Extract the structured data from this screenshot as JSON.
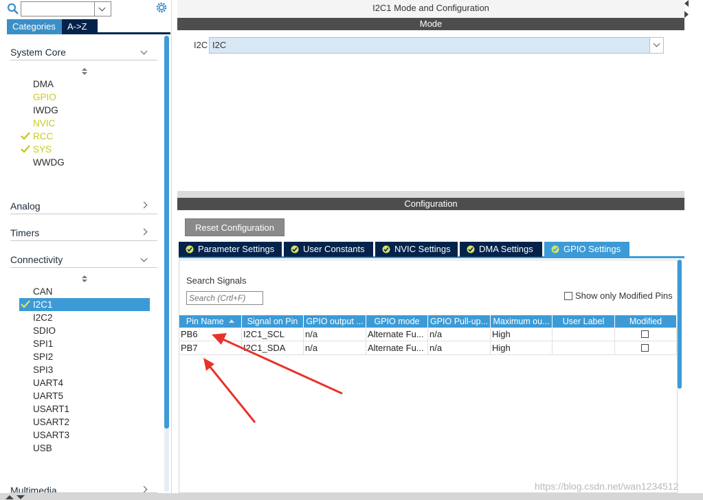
{
  "left_panel": {
    "tabs": {
      "categories": "Categories",
      "az": "A->Z"
    },
    "sections": {
      "system_core": {
        "title": "System Core",
        "items": [
          "DMA",
          "GPIO",
          "IWDG",
          "NVIC",
          "RCC",
          "SYS",
          "WWDG"
        ]
      },
      "analog": {
        "title": "Analog"
      },
      "timers": {
        "title": "Timers"
      },
      "connectivity": {
        "title": "Connectivity",
        "items": [
          "CAN",
          "I2C1",
          "I2C2",
          "SDIO",
          "SPI1",
          "SPI2",
          "SPI3",
          "UART4",
          "UART5",
          "USART1",
          "USART2",
          "USART3",
          "USB"
        ]
      },
      "multimedia": {
        "title": "Multimedia"
      }
    }
  },
  "main": {
    "title": "I2C1 Mode and Configuration",
    "mode_header": "Mode",
    "i2c_label": "I2C",
    "i2c_value": "I2C",
    "config_header": "Configuration",
    "reset_button": "Reset Configuration",
    "tabs": [
      "Parameter Settings",
      "User Constants",
      "NVIC Settings",
      "DMA Settings",
      "GPIO Settings"
    ],
    "search_label": "Search Signals",
    "search_placeholder": "Search (Crtl+F)",
    "show_modified": "Show only Modified Pins",
    "table": {
      "headers": [
        "Pin Name",
        "Signal on Pin",
        "GPIO output ...",
        "GPIO mode",
        "GPIO Pull-up...",
        "Maximum ou...",
        "User Label",
        "Modified"
      ],
      "rows": [
        [
          "PB6",
          "I2C1_SCL",
          "n/a",
          "Alternate Fu...",
          "n/a",
          "High",
          "",
          ""
        ],
        [
          "PB7",
          "I2C1_SDA",
          "n/a",
          "Alternate Fu...",
          "n/a",
          "High",
          "",
          ""
        ]
      ]
    }
  },
  "watermark": "https://blog.csdn.net/wan1234512",
  "colors": {
    "accent_blue": "#3c9bd6",
    "navy": "#03234b",
    "warning_yellow": "#c9c81e",
    "annotation_red": "#e8332b"
  }
}
